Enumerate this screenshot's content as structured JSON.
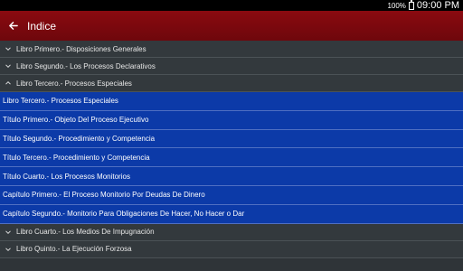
{
  "status": {
    "battery": "100%",
    "time": "09:00 PM"
  },
  "appbar": {
    "title": "Indice"
  },
  "groups_top": [
    {
      "label": "Libro Primero.- Disposiciones Generales",
      "expanded": false
    },
    {
      "label": "Libro Segundo.- Los Procesos Declarativos",
      "expanded": false
    },
    {
      "label": "Libro Tercero.- Procesos Especiales",
      "expanded": true
    }
  ],
  "children": [
    "Libro Tercero.- Procesos Especiales",
    "Título Primero.- Objeto Del Proceso Ejecutivo",
    "Título Segundo.- Procedimiento y Competencia",
    "Título Tercero.- Procedimiento y Competencia",
    "Título Cuarto.- Los Procesos Monitorios",
    "Capítulo Primero.- El Proceso Monitorio Por Deudas De Dinero",
    "Capítulo Segundo.- Monitorio Para Obligaciones De Hacer, No Hacer o Dar"
  ],
  "groups_bottom": [
    {
      "label": "Libro Cuarto.- Los Medios De Impugnación",
      "expanded": false
    },
    {
      "label": "Libro Quinto.- La Ejecución Forzosa",
      "expanded": false
    }
  ]
}
